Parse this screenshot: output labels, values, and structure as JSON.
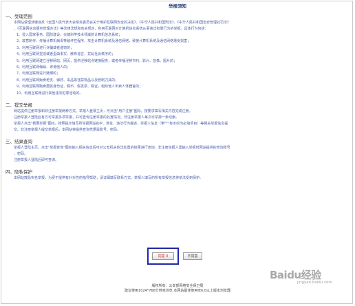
{
  "page": {
    "title": "举报须知",
    "sections": [
      {
        "heading": "一、受理范围",
        "intro_lines": [
          "本网站受理涉嫌违反《全国人民代表大会常务委员会关于维护互联网安全的决定》、《中华人民共和国刑法》、《中华人民共和国治安管理处罚法》",
          "、《互联网信息服务管理办法》等法律法规和有关规定，利用互联网对计算机信息系统从事违法犯罪行为的举报。具体行为包括："
        ],
        "items": [
          "1、侵入国家事务、国防建设、尖端科学技术领域的计算机信息系统；",
          "2、故意制作、传播计算机病毒等破坏性程序，攻击计算机系统及通信网络，致使计算机系统及通信网络遭受损害；",
          "3、利用互联网进行诈骗或者盗窃的；",
          "4、利用互联网捏造或者歪曲事实、散布谣言，扰乱社会秩序的；",
          "5、利用互联网建立淫秽网站、网页，提供淫秽站点链接服务，或者传播淫秽书刊、影片、音像、图片的；",
          "6、利用互联网侮辱、诽谤他人的；",
          "7、利用互联网进行赌博的；",
          "8、利用互联网贩卖枪支、弹药、毒品等违禁物品以及管制刀具的；",
          "9、利用互联网贩卖居民身份证、假币、假发票、假证，组织他人出卖人体器官的；",
          "10、利用互联网进行其他违法犯罪活动的。"
        ]
      },
      {
        "heading": "二、提交举报",
        "lines": [
          "网站提供注册举报和非注册举报两种方式。举报人登录主页，可点击\"用户注册\"图标，按要求填写相关内容完成注册。",
          "注册举报人登陆后有方可举报多项举报，并可查询注册举报的处置情况。非注册举报人每次可举报一条线索。",
          "举报人点击\"我要举报\"图标，按照提示填写所举报网站的IP、地址、违法行为描述，举报人信息（带\"*\"标示的为必填项目）等相关举报信息提",
          "交。非注册举报人提交举报后，本网站将提供查询凭据是账号、密码。"
        ]
      },
      {
        "heading": "三、结果查询",
        "lines": [
          "举报人登陆主页，点击\"举报查询\"图标输入相关信息后可对公安机关依法处置的结果进行查询。非注册举报人需输入举报时网站提供的查询账号",
          "、密码。",
          "注册举报人登陆后即可查询。"
        ]
      },
      {
        "heading": "四、隐私保护",
        "lines": [
          "本网站鼓励实名举报，为便于提供有针对性的指导帮助，请详细填写联系方式。举报人填写的所有举报信息将依法受到保护。"
        ]
      }
    ]
  },
  "buttons": {
    "agree_label": "同意 0",
    "disagree_label": "不同意"
  },
  "footer": {
    "line1": "版权所有：公安部网络安全保卫局",
    "line2": "建议使用1024*768分辨率浏览 本网站最佳使用IE6.0以上版本浏览器"
  },
  "watermark": {
    "logo": "Baidu经验",
    "sub": "jingyan.baidu.com"
  }
}
